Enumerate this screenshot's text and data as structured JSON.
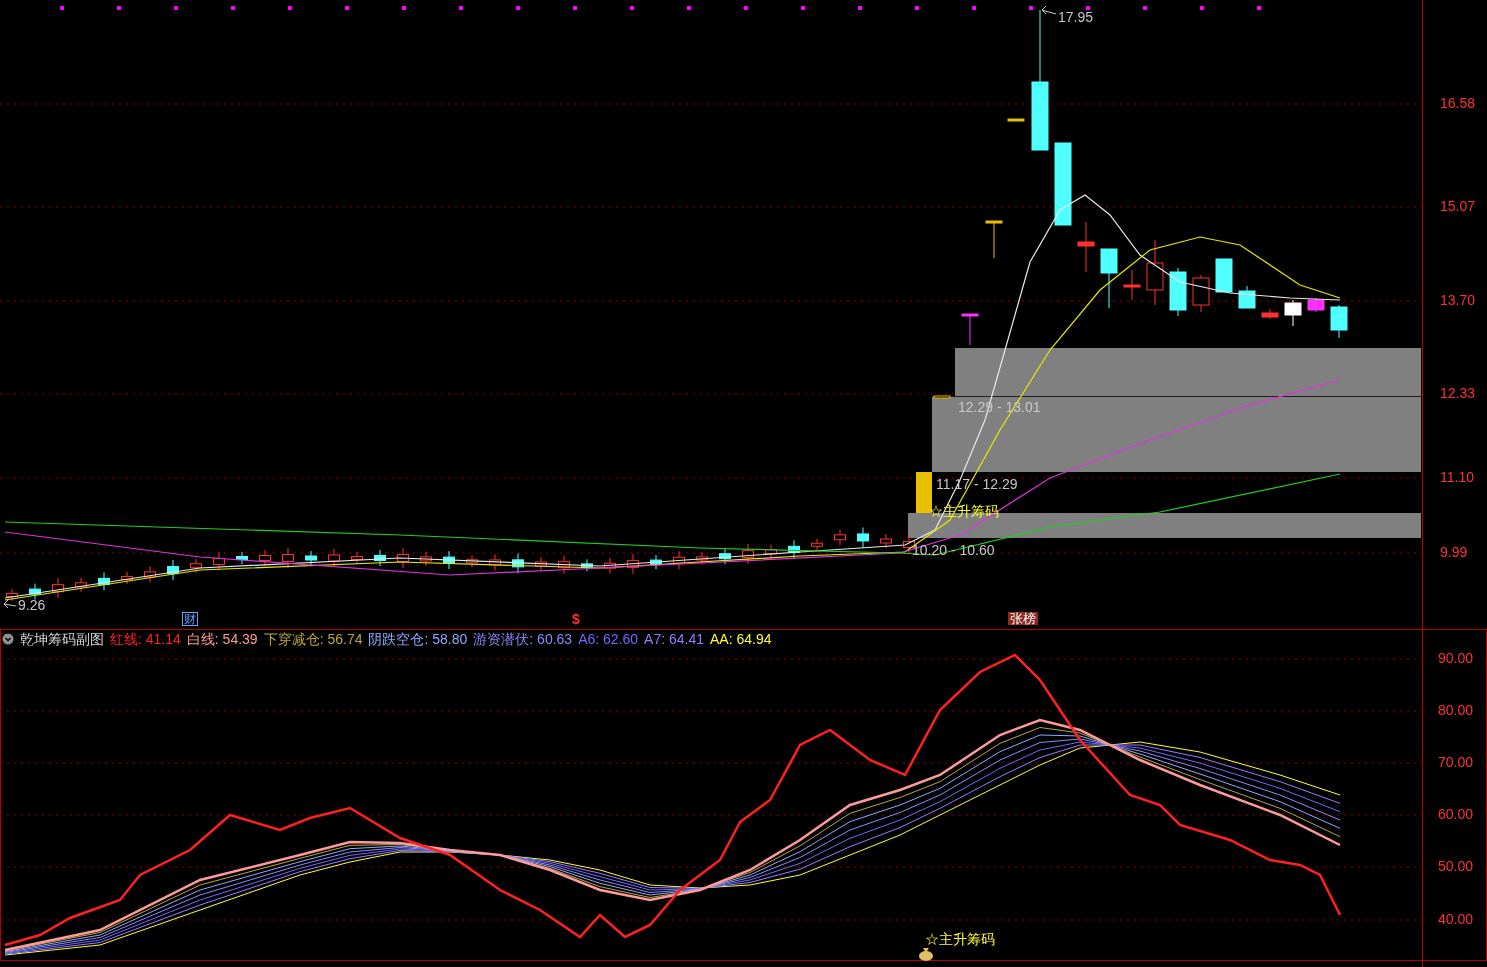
{
  "main_chart": {
    "high_label": "17.95",
    "low_label": "9.26",
    "price_axis": [
      "16.58",
      "15.07",
      "13.70",
      "12.33",
      "11.10",
      "9.99"
    ],
    "chip_zones": [
      {
        "range": "12.29 - 13.01"
      },
      {
        "range": "11.17 - 12.29"
      },
      {
        "range": "10.20 - 10.60"
      }
    ],
    "signal_label": "☆主升筹码",
    "markers": [
      {
        "text": "财",
        "kind": "box"
      },
      {
        "text": "$",
        "kind": "plain"
      },
      {
        "text": "张榜",
        "kind": "tag"
      }
    ]
  },
  "indicator": {
    "title": "乾坤筹码副图",
    "legend": [
      {
        "label": "红线:",
        "value": "41.14",
        "color": "#ff2020"
      },
      {
        "label": "白线:",
        "value": "54.39",
        "color": "#ff9a9a"
      },
      {
        "label": "下穿减仓:",
        "value": "56.74",
        "color": "#b8a838"
      },
      {
        "label": "阴跌空仓:",
        "value": "58.80",
        "color": "#8ea8ff"
      },
      {
        "label": "游资潜伏:",
        "value": "60.63",
        "color": "#8a8aff"
      },
      {
        "label": "A6:",
        "value": "62.60",
        "color": "#6a6aff"
      },
      {
        "label": "A7:",
        "value": "64.41",
        "color": "#9a7aff"
      },
      {
        "label": "AA:",
        "value": "64.94",
        "color": "#ffff30"
      }
    ],
    "value_axis": [
      "90.00",
      "80.00",
      "70.00",
      "60.00",
      "50.00",
      "40.00"
    ],
    "signal_label": "☆主升筹码"
  }
}
